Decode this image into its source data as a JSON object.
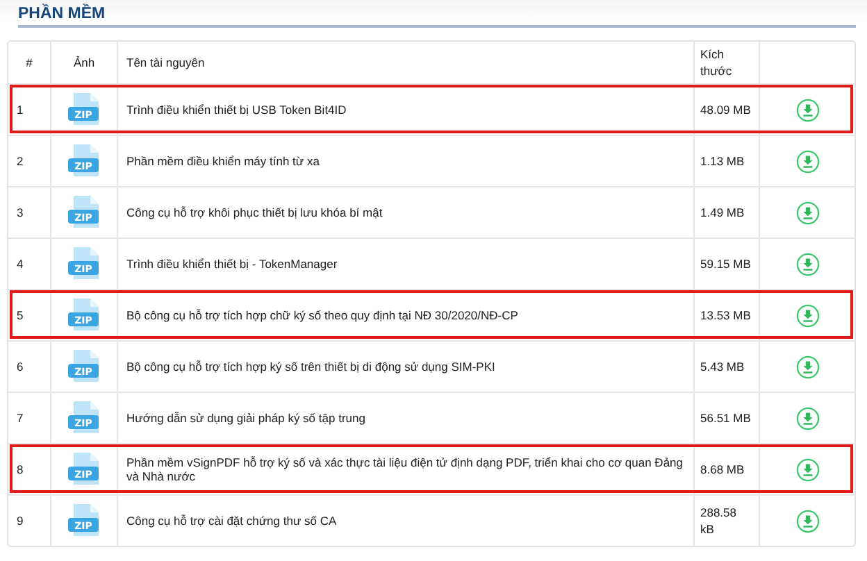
{
  "section_title": "PHẦN MỀM",
  "table": {
    "columns": [
      "#",
      "Ảnh",
      "Tên tài nguyên",
      "Kích thước"
    ],
    "rows": [
      {
        "index": "1",
        "file_type": "ZIP",
        "name": "Trình điều khiển thiết bị USB Token Bit4ID",
        "size": "48.09 MB",
        "highlighted": true
      },
      {
        "index": "2",
        "file_type": "ZIP",
        "name": "Phần mềm điều khiển máy tính từ xa",
        "size": "1.13 MB",
        "highlighted": false
      },
      {
        "index": "3",
        "file_type": "ZIP",
        "name": "Công cụ hỗ trợ khôi phục thiết bị lưu khóa bí mật",
        "size": "1.49 MB",
        "highlighted": false
      },
      {
        "index": "4",
        "file_type": "ZIP",
        "name": "Trình điều khiển thiết bị - TokenManager",
        "size": "59.15 MB",
        "highlighted": false
      },
      {
        "index": "5",
        "file_type": "ZIP",
        "name": "Bộ công cụ hỗ trợ tích hợp chữ ký số theo quy định tại NĐ 30/2020/NĐ-CP",
        "size": "13.53 MB",
        "highlighted": true
      },
      {
        "index": "6",
        "file_type": "ZIP",
        "name": "Bộ công cụ hỗ trợ tích hợp ký số trên thiết bị di động sử dụng SIM-PKI",
        "size": "5.43 MB",
        "highlighted": false
      },
      {
        "index": "7",
        "file_type": "ZIP",
        "name": "Hướng dẫn sử dụng giải pháp ký số tập trung",
        "size": "56.51 MB",
        "highlighted": false
      },
      {
        "index": "8",
        "file_type": "ZIP",
        "name": "Phần mềm vSignPDF hỗ trợ ký số và xác thực tài liệu điện tử định dạng PDF, triển khai cho cơ quan Đảng và Nhà nước",
        "size": "8.68 MB",
        "highlighted": true
      },
      {
        "index": "9",
        "file_type": "ZIP",
        "name": "Công cụ hỗ trợ cài đặt chứng thư số CA",
        "size": "288.58 kB",
        "highlighted": false
      }
    ]
  }
}
